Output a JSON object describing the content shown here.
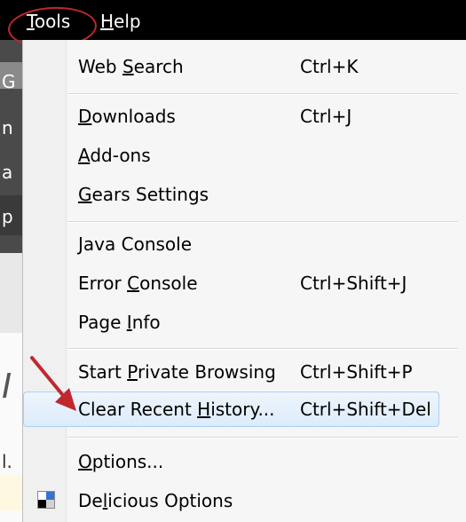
{
  "menubar": {
    "items": [
      {
        "label": "Tools",
        "mnemonic": "T",
        "rest": "ools"
      },
      {
        "label": "Help",
        "mnemonic": "H",
        "rest": "elp"
      }
    ]
  },
  "background_page": {
    "chars": [
      "G",
      "n",
      "a",
      "p",
      "I",
      "l."
    ]
  },
  "menu": {
    "items": [
      {
        "label": "Web Search",
        "pre": "Web ",
        "mnemonic": "S",
        "post": "earch",
        "shortcut": "Ctrl+K"
      },
      {
        "label": "Downloads",
        "pre": "",
        "mnemonic": "D",
        "post": "ownloads",
        "shortcut": "Ctrl+J"
      },
      {
        "label": "Add-ons",
        "pre": "",
        "mnemonic": "A",
        "post": "dd-ons",
        "shortcut": ""
      },
      {
        "label": "Gears Settings",
        "pre": "",
        "mnemonic": "G",
        "post": "ears Settings",
        "shortcut": ""
      },
      {
        "label": "Java Console",
        "pre": "",
        "mnemonic": "J",
        "post": "ava Console",
        "shortcut": ""
      },
      {
        "label": "Error Console",
        "pre": "Error ",
        "mnemonic": "C",
        "post": "onsole",
        "shortcut": "Ctrl+Shift+J"
      },
      {
        "label": "Page Info",
        "pre": "Page ",
        "mnemonic": "I",
        "post": "nfo",
        "shortcut": ""
      },
      {
        "label": "Start Private Browsing",
        "pre": "Start ",
        "mnemonic": "P",
        "post": "rivate Browsing",
        "shortcut": "Ctrl+Shift+P"
      },
      {
        "label": "Clear Recent History...",
        "pre": "Clear Recent ",
        "mnemonic": "H",
        "post": "istory...",
        "shortcut": "Ctrl+Shift+Del"
      },
      {
        "label": "Options...",
        "pre": "",
        "mnemonic": "O",
        "post": "ptions...",
        "shortcut": ""
      },
      {
        "label": "Delicious Options",
        "pre": "De",
        "mnemonic": "l",
        "post": "icious Options",
        "shortcut": "",
        "icon": "delicious-icon"
      }
    ],
    "highlighted_index": 8
  },
  "annotations": {
    "ellipse_color": "#c1272d",
    "arrow_color": "#c1272d"
  },
  "colors": {
    "menubar_bg": "#000000",
    "menu_bg": "#f6f6f6",
    "highlight_border": "#a8d1f7"
  }
}
